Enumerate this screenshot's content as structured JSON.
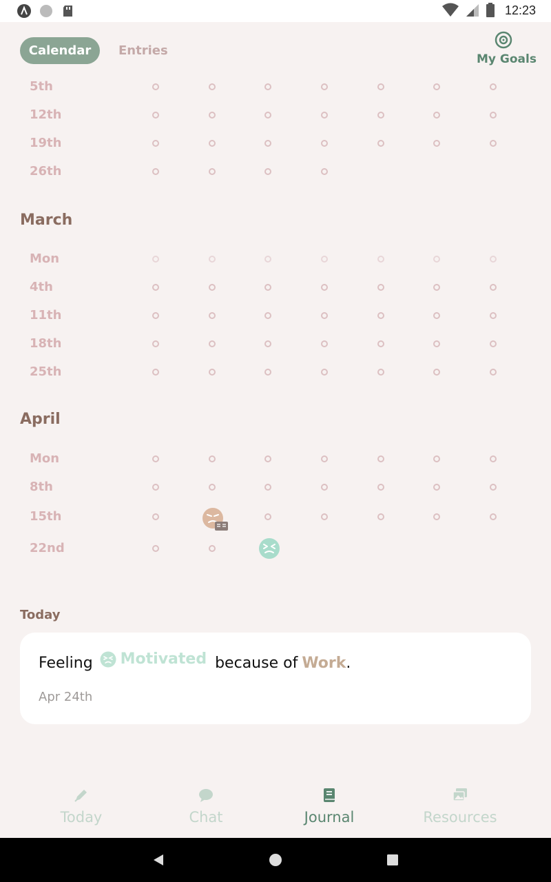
{
  "status_bar": {
    "time": "12:23",
    "icons_left": [
      "app-launcher-icon",
      "circle-icon",
      "sd-card-icon"
    ],
    "icons_right": [
      "wifi-icon",
      "signal-icon",
      "battery-icon"
    ]
  },
  "header": {
    "tabs": [
      {
        "label": "Calendar",
        "active": true
      },
      {
        "label": "Entries",
        "active": false
      }
    ],
    "goals_label": "My Goals"
  },
  "calendar": {
    "prev_month_rows": [
      "5th",
      "12th",
      "19th",
      "26th"
    ],
    "months": [
      {
        "name": "March",
        "rows": [
          "Mon",
          "4th",
          "11th",
          "18th",
          "25th"
        ]
      },
      {
        "name": "April",
        "rows": [
          "Mon",
          "8th",
          "15th",
          "22nd"
        ]
      }
    ],
    "entries": [
      {
        "week": "15th",
        "day_index": 1,
        "mood": "angry",
        "color": "#dcb8a0",
        "has_note": true
      },
      {
        "week": "22nd",
        "day_index": 2,
        "mood": "motivated",
        "color": "#a8dccb",
        "has_note": false
      }
    ]
  },
  "today": {
    "title": "Today",
    "prefix": "Feeling",
    "mood": "Motivated",
    "middle": "because of",
    "reason": "Work",
    "suffix": ".",
    "date": "Apr 24th"
  },
  "nav": {
    "items": [
      {
        "label": "Today",
        "icon": "pen-icon"
      },
      {
        "label": "Chat",
        "icon": "chat-bubble-icon"
      },
      {
        "label": "Journal",
        "icon": "journal-book-icon",
        "active": true
      },
      {
        "label": "Resources",
        "icon": "images-icon"
      }
    ]
  },
  "colors": {
    "accent": "#8ba594",
    "accent_dark": "#5a8670",
    "label_pink": "#d8b3b5",
    "heading_brown": "#8a6c60",
    "background": "#f7f2f1"
  }
}
